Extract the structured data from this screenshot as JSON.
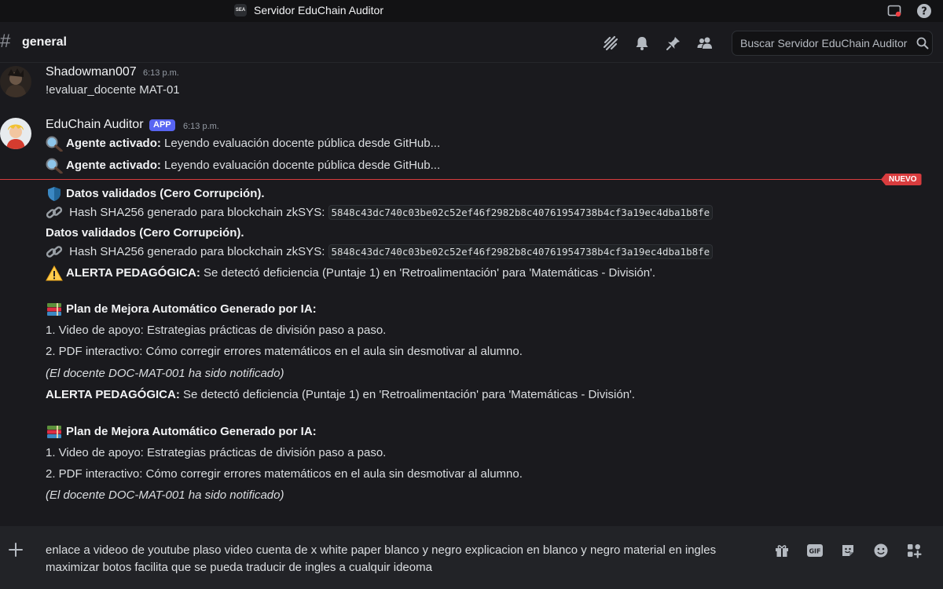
{
  "window": {
    "server_badge": "SEA",
    "title": "Servidor EduChain Auditor"
  },
  "channel": {
    "hash": "#",
    "name": "general",
    "search_placeholder": "Buscar Servidor EduChain Auditor"
  },
  "messages": [
    {
      "author": "Shadowman007",
      "time": "6:13 p.m.",
      "lines": [
        "!evaluar_docente MAT-01"
      ]
    },
    {
      "author": "EduChain Auditor",
      "badge": "APP",
      "time": "6:13 p.m.",
      "agent_label": "Agente activado:",
      "agent_text": " Leyendo evaluación docente pública desde GitHub...",
      "validated": "Datos validados (Cero Corrupción).",
      "hash_label": " Hash SHA256 generado para blockchain zkSYS: ",
      "hash_value": "5848c43dc740c03be02c52ef46f2982b8c40761954738b4cf3a19ec4dba1b8fe",
      "alert_label": "ALERTA PEDAGÓGICA:",
      "alert_text": " Se detectó deficiencia (Puntaje 1) en 'Retroalimentación' para 'Matemáticas - División'.",
      "plan_title": "Plan de Mejora Automático Generado por IA:",
      "plan_item_1": "1. Video de apoyo: Estrategias prácticas de división paso a paso.",
      "plan_item_2": "2. PDF interactivo: Cómo corregir errores matemáticos en el aula sin desmotivar al alumno.",
      "notified": "(El docente DOC-MAT-001 ha sido notificado)"
    }
  ],
  "new_divider": "NUEVO",
  "composer": {
    "text_line_1": "enlace a videoo de youtube plaso video cuenta de x white paper blanco y negro explicacion en blanco y negro material en ingles",
    "text_line_2": "maximizar botos facilita que se pueda traducir de ingles a cualquir ideoma",
    "gif_label": "GIF"
  },
  "colors": {
    "accent": "#5865f2",
    "new_red": "#d83c3e",
    "background": "#1a1a1e"
  },
  "icons": [
    "inbox-icon",
    "help-icon",
    "threads-icon",
    "bell-icon",
    "pin-icon",
    "members-icon",
    "search-icon",
    "plus-icon",
    "gift-icon",
    "gif-icon",
    "sticker-icon",
    "emoji-icon",
    "apps-icon"
  ]
}
